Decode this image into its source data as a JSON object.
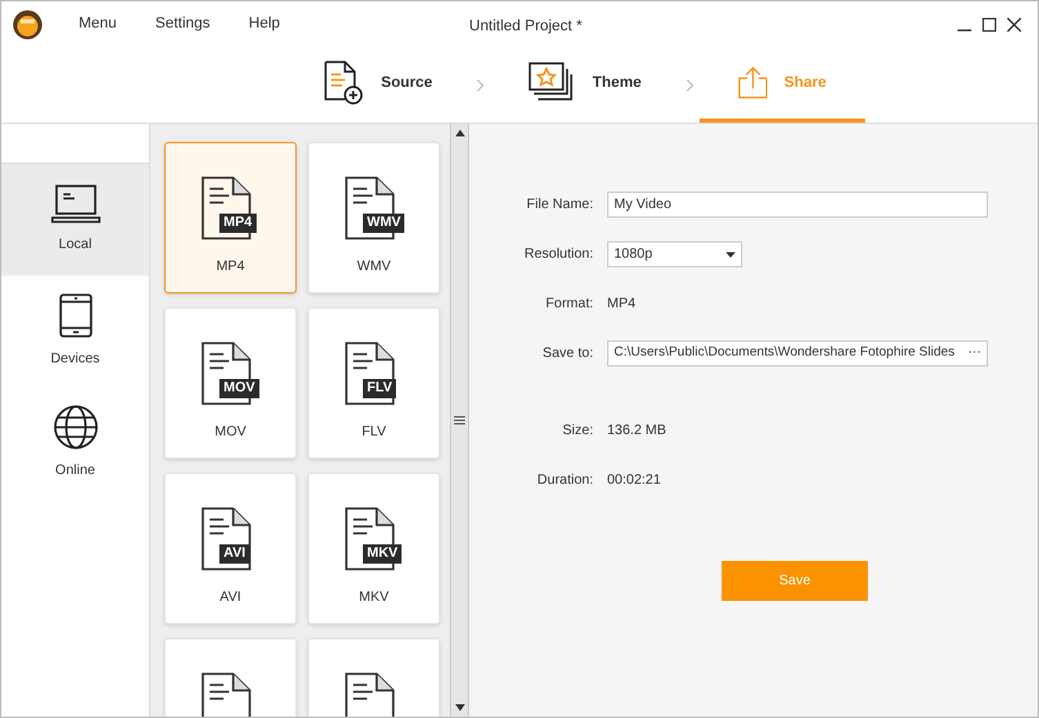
{
  "window": {
    "title": "Untitled Project *"
  },
  "menu": [
    "Menu",
    "Settings",
    "Help"
  ],
  "steps": [
    {
      "label": "Source",
      "kind": "source",
      "selected": false
    },
    {
      "label": "Theme",
      "kind": "theme",
      "selected": false
    },
    {
      "label": "Share",
      "kind": "share",
      "selected": true
    }
  ],
  "sidebar": {
    "items": [
      {
        "label": "Local",
        "kind": "laptop",
        "selected": true
      },
      {
        "label": "Devices",
        "kind": "phone",
        "selected": false
      },
      {
        "label": "Online",
        "kind": "globe",
        "selected": false
      }
    ]
  },
  "formats": [
    {
      "kind": "full",
      "label": "MP4",
      "badge": "MP4",
      "selected": true
    },
    {
      "kind": "full",
      "label": "WMV",
      "badge": "WMV",
      "selected": false
    },
    {
      "kind": "full",
      "label": "MOV",
      "badge": "MOV",
      "selected": false
    },
    {
      "kind": "full",
      "label": "FLV",
      "badge": "FLV",
      "selected": false
    },
    {
      "kind": "full",
      "label": "AVI",
      "badge": "AVI",
      "selected": false
    },
    {
      "kind": "full",
      "label": "MKV",
      "badge": "MKV",
      "selected": false
    },
    {
      "kind": "partial",
      "selected": false
    },
    {
      "kind": "partial",
      "selected": false
    }
  ],
  "form": {
    "file_name": {
      "label": "File Name:",
      "value": "My Video"
    },
    "resolution": {
      "label": "Resolution:",
      "value": "1080p"
    },
    "format": {
      "label": "Format:",
      "value": "MP4"
    },
    "save_to": {
      "label": "Save to:",
      "value": "C:\\Users\\Public\\Documents\\Wondershare Fotophire Slides",
      "browse": "···"
    },
    "size": {
      "label": "Size:",
      "value": "136.2 MB"
    },
    "duration": {
      "label": "Duration:",
      "value": "00:02:21"
    }
  },
  "save_button": "Save"
}
